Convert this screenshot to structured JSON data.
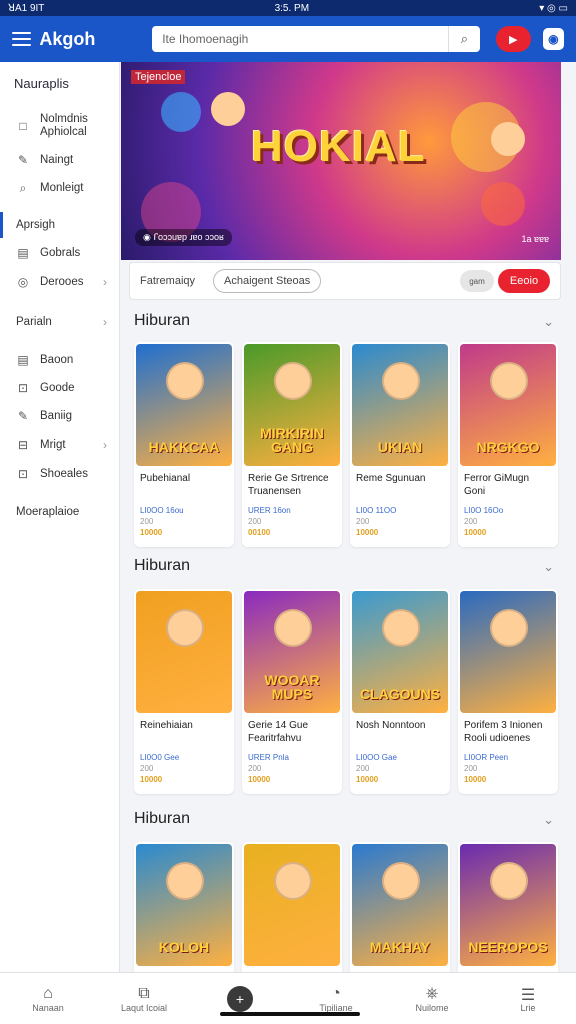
{
  "status_bar": {
    "carrier": "ꓤA1 9IT",
    "time": "3:5. PM",
    "icons": "▾ ◎ ▭"
  },
  "header": {
    "app_title": "Akgoh",
    "search_placeholder": "Ite Ihomoenagih",
    "search_icon": "search-icon",
    "yt_icon": "play-icon",
    "account_icon": "account-icon"
  },
  "sidebar": {
    "heading": "Nauraplis",
    "items": [
      {
        "label": "Nolmdnis Aphiolcal",
        "icon": "□"
      },
      {
        "label": "Naingt",
        "icon": "✎"
      },
      {
        "label": "Monleigt",
        "icon": "⌕"
      },
      {
        "label": "Aprsigh",
        "icon": ""
      },
      {
        "label": "Gobrals",
        "icon": "▤"
      },
      {
        "label": "Derooes",
        "icon": "◎"
      },
      {
        "label": "Parialn",
        "icon": ""
      },
      {
        "label": "Baoon",
        "icon": "▤"
      },
      {
        "label": "Goode",
        "icon": "⊡"
      },
      {
        "label": "Baniig",
        "icon": "✎"
      },
      {
        "label": "Mrigt",
        "icon": "⊟"
      },
      {
        "label": "Shoeales",
        "icon": "⊡"
      },
      {
        "label": "Moeraplaioe",
        "icon": ""
      }
    ]
  },
  "banner": {
    "tag": "Tejencloe",
    "title": "HOKIAL",
    "subtitle": "◉ ꓩoɔɔuɐp ɹɐo ɔɔoʁ",
    "counter": "1a ɐɐɐ"
  },
  "filters": {
    "filter1": "Fatremaiqy",
    "filter2": "Achaigent Steoas",
    "switch_label": "gam",
    "cta": "Eeoio"
  },
  "sections": [
    {
      "title": "Hiburan",
      "cards": [
        {
          "thumb_title": "HAKKCAA",
          "name": "Pubehianal",
          "meta1": "LI0OO 16ou",
          "meta2": "200",
          "meta3": "10000",
          "bg": "#1f6fd0"
        },
        {
          "thumb_title": "MIRKIRIN GANG",
          "name": "Rerie Ge Srtrence Truanensen",
          "meta1": "URER 16on",
          "meta2": "200",
          "meta3": "00100",
          "bg": "#4a9a2a"
        },
        {
          "thumb_title": "UKIAN",
          "name": "Reme Sgunuan",
          "meta1": "LI0O 11OO",
          "meta2": "200",
          "meta3": "10000",
          "bg": "#2a8ad0"
        },
        {
          "thumb_title": "NRGKGO",
          "name": "Ferror GiMugn Goni",
          "meta1": "LI0O 16Oo",
          "meta2": "200",
          "meta3": "10000",
          "bg": "#c03a8a"
        }
      ]
    },
    {
      "title": "Hiburan",
      "cards": [
        {
          "thumb_title": "",
          "name": "Reinehiaian",
          "meta1": "LI0O0 Gee",
          "meta2": "200",
          "meta3": "10000",
          "bg": "#f0a020"
        },
        {
          "thumb_title": "WOOAR MUPS",
          "name": "Gerie 14 Gue Fearitrfahvu",
          "meta1": "URER Pnla",
          "meta2": "200",
          "meta3": "10000",
          "bg": "#8a2ac0"
        },
        {
          "thumb_title": "CLAGOUNS",
          "name": "Nosh Nonntoon",
          "meta1": "LI0OO Gae",
          "meta2": "200",
          "meta3": "10000",
          "bg": "#3a9ad0"
        },
        {
          "thumb_title": "",
          "name": "Porifem 3 Inionen Rooli udioenes",
          "meta1": "LI0OR Peen",
          "meta2": "200",
          "meta3": "10000",
          "bg": "#2a6ac0"
        }
      ]
    },
    {
      "title": "Hiburan",
      "cards": [
        {
          "thumb_title": "KOLOH",
          "name": "",
          "meta1": "",
          "meta2": "",
          "meta3": "",
          "bg": "#2a8ad0"
        },
        {
          "thumb_title": "",
          "name": "",
          "meta1": "",
          "meta2": "",
          "meta3": "",
          "bg": "#e8b020"
        },
        {
          "thumb_title": "MAKHAY",
          "name": "",
          "meta1": "",
          "meta2": "",
          "meta3": "",
          "bg": "#2a7ad0"
        },
        {
          "thumb_title": "NEEROPOS",
          "name": "",
          "meta1": "",
          "meta2": "",
          "meta3": "",
          "bg": "#6a2ab0"
        }
      ]
    }
  ],
  "bottom_nav": [
    {
      "label": "Nanaan",
      "icon": "⌂"
    },
    {
      "label": "Laqut Icoial",
      "icon": "⧉"
    },
    {
      "label": "",
      "icon": "+"
    },
    {
      "label": "Tipiliane",
      "icon": "◔"
    },
    {
      "label": "Nuilome",
      "icon": "⎈"
    },
    {
      "label": "Lrie",
      "icon": "☰"
    }
  ]
}
